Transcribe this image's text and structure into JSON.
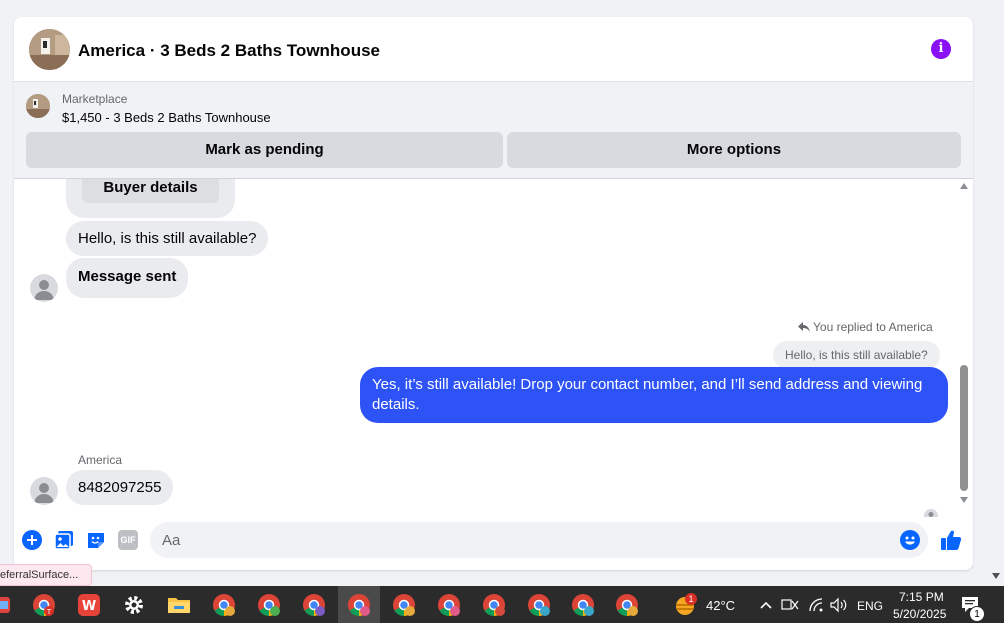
{
  "header": {
    "title": "America · 3 Beds 2 Baths Townhouse",
    "info_glyph": "i",
    "icons": [
      "listing-photo",
      "info-icon"
    ]
  },
  "marketplace": {
    "label": "Marketplace",
    "listing": "$1,450 - 3 Beds 2 Baths Townhouse",
    "mark_pending_label": "Mark as pending",
    "more_options_label": "More options"
  },
  "messages": {
    "buyer_details_label": "Buyer details",
    "in_1": "Hello, is this still available?",
    "in_2": "Message sent",
    "replied_meta": "You replied to America",
    "reply_quote": "Hello, is this still available?",
    "out_1": "Yes, it’s still available! Drop your contact number, and I’ll send address and viewing details.",
    "sender_name": "America",
    "in_3": "8482097255"
  },
  "composer": {
    "placeholder": "Aa",
    "gif_label": "GIF",
    "icons": [
      "plus-icon",
      "photo-icon",
      "sticker-icon",
      "gif-icon",
      "emoji-icon",
      "thumbs-up-icon"
    ]
  },
  "tooltip": {
    "text": "eferralSurface..."
  },
  "taskbar": {
    "weather_temp": "42°C",
    "weather_badge": "1",
    "language": "ENG",
    "time": "7:15 PM",
    "date": "5/20/2025",
    "notification_count": "1"
  },
  "colors": {
    "outgoing_bubble": "#2d52f5",
    "info_icon": "#8a10f5",
    "accent_blue": "#0866ff"
  }
}
